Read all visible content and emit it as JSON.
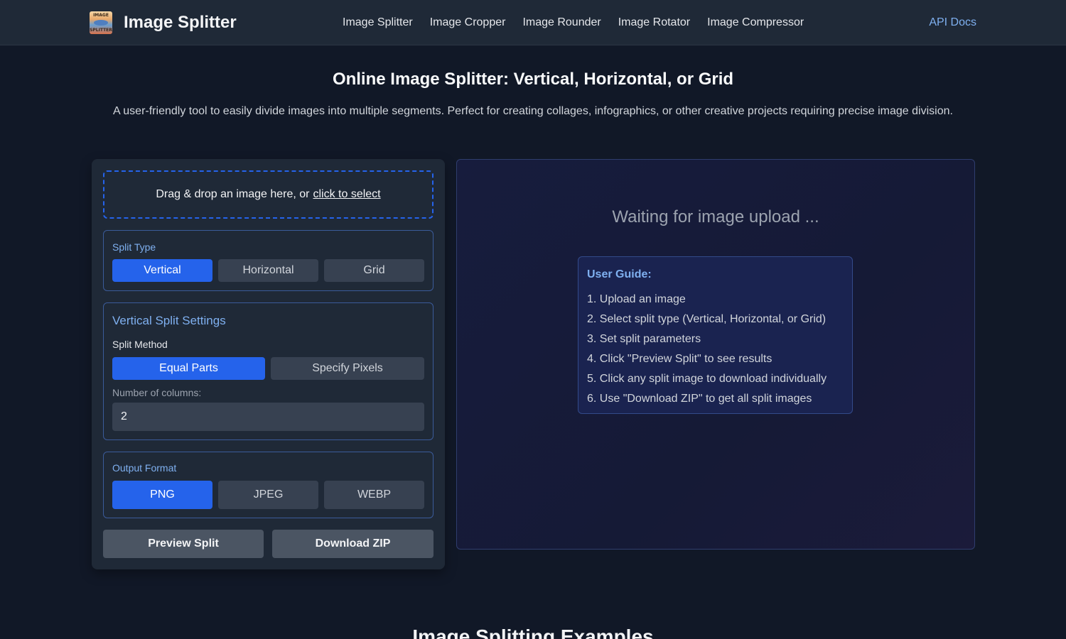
{
  "header": {
    "logo_text_top": "IMAGE",
    "logo_text_bottom": "SPLITTER",
    "brand": "Image Splitter",
    "nav": [
      "Image Splitter",
      "Image Cropper",
      "Image Rounder",
      "Image Rotator",
      "Image Compressor"
    ],
    "api_docs": "API Docs"
  },
  "hero": {
    "title": "Online Image Splitter: Vertical, Horizontal, or Grid",
    "description": "A user-friendly tool to easily divide images into multiple segments. Perfect for creating collages, infographics, or other creative projects requiring precise image division."
  },
  "upload": {
    "text": "Drag & drop an image here, or",
    "link": "click to select"
  },
  "split_type": {
    "label": "Split Type",
    "options": [
      "Vertical",
      "Horizontal",
      "Grid"
    ],
    "selected": "Vertical"
  },
  "vertical_settings": {
    "title": "Vertical Split Settings",
    "method_label": "Split Method",
    "methods": [
      "Equal Parts",
      "Specify Pixels"
    ],
    "selected_method": "Equal Parts",
    "columns_label": "Number of columns:",
    "columns_value": "2"
  },
  "output_format": {
    "label": "Output Format",
    "options": [
      "PNG",
      "JPEG",
      "WEBP"
    ],
    "selected": "PNG"
  },
  "actions": {
    "preview": "Preview Split",
    "download": "Download ZIP"
  },
  "preview_panel": {
    "waiting": "Waiting for image upload ...",
    "guide_title": "User Guide:",
    "steps": [
      "1. Upload an image",
      "2. Select split type (Vertical, Horizontal, or Grid)",
      "3. Set split parameters",
      "4. Click \"Preview Split\" to see results",
      "5. Click any split image to download individually",
      "6. Use \"Download ZIP\" to get all split images"
    ]
  },
  "examples": {
    "title": "Image Splitting Examples"
  },
  "colors": {
    "accent": "#2563eb",
    "link": "#7fb0f0",
    "background": "#111827",
    "panel": "#1f2937"
  }
}
